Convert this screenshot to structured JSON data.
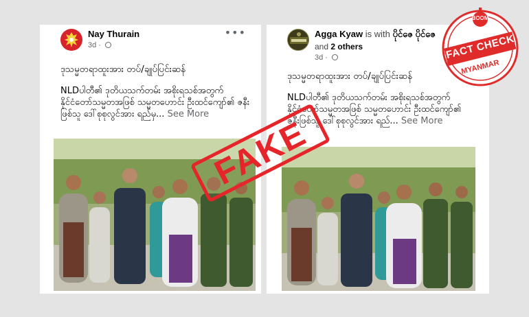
{
  "left_post": {
    "author": "Nay Thurain",
    "time": "3d",
    "menu": "•••",
    "headline": "ဒုသမ္မတရာထူးအား တပ်/ချုပ်ပြင်းဆန်",
    "body": "NLDပါတီ၏ ဒုတိယသက်တမ်း အစိုးရသစ်အတွက် နိုင်ငံတော်သမ္မတအဖြစ် သမ္မတဟောင်း ဦးထင်ကျော်၏ ဇနီးဖြစ်သူ ဒေါ်စုစုလွင်အား ရည်မှ...",
    "see_more": "See More"
  },
  "right_post": {
    "author": "Agga Kyaw",
    "is_with": "is with",
    "tagged": "ပိုင်ဇေ ပိုင်ဇေ",
    "and": "and",
    "others": "2 others",
    "time": "3d",
    "headline": "ဒုသမ္မတရာထူးအား တပ်/ချုပ်ပြင်းဆန်",
    "body": "NLDပါတီ၏ ဒုတိယသက်တမ်း အစိုးရသစ်အတွက် နိုင်ငံတော်သမ္မတအဖြစ် သမ္မတဟောင်း ဦးထင်ကျော်၏ ဇနီးဖြစ်သူ ဒေါ်စုစုလွင်အား ရည်...",
    "see_more": "See More"
  },
  "stamp": {
    "text": "FAKE",
    "color": "#e5252a"
  },
  "badge": {
    "top": "BOOM",
    "main": "FACT CHECK",
    "bottom": "MYANMAR",
    "color": "#e02b2b"
  },
  "colors": {
    "link": "#385898",
    "muted": "#65676b",
    "background": "#e4e4e4"
  }
}
